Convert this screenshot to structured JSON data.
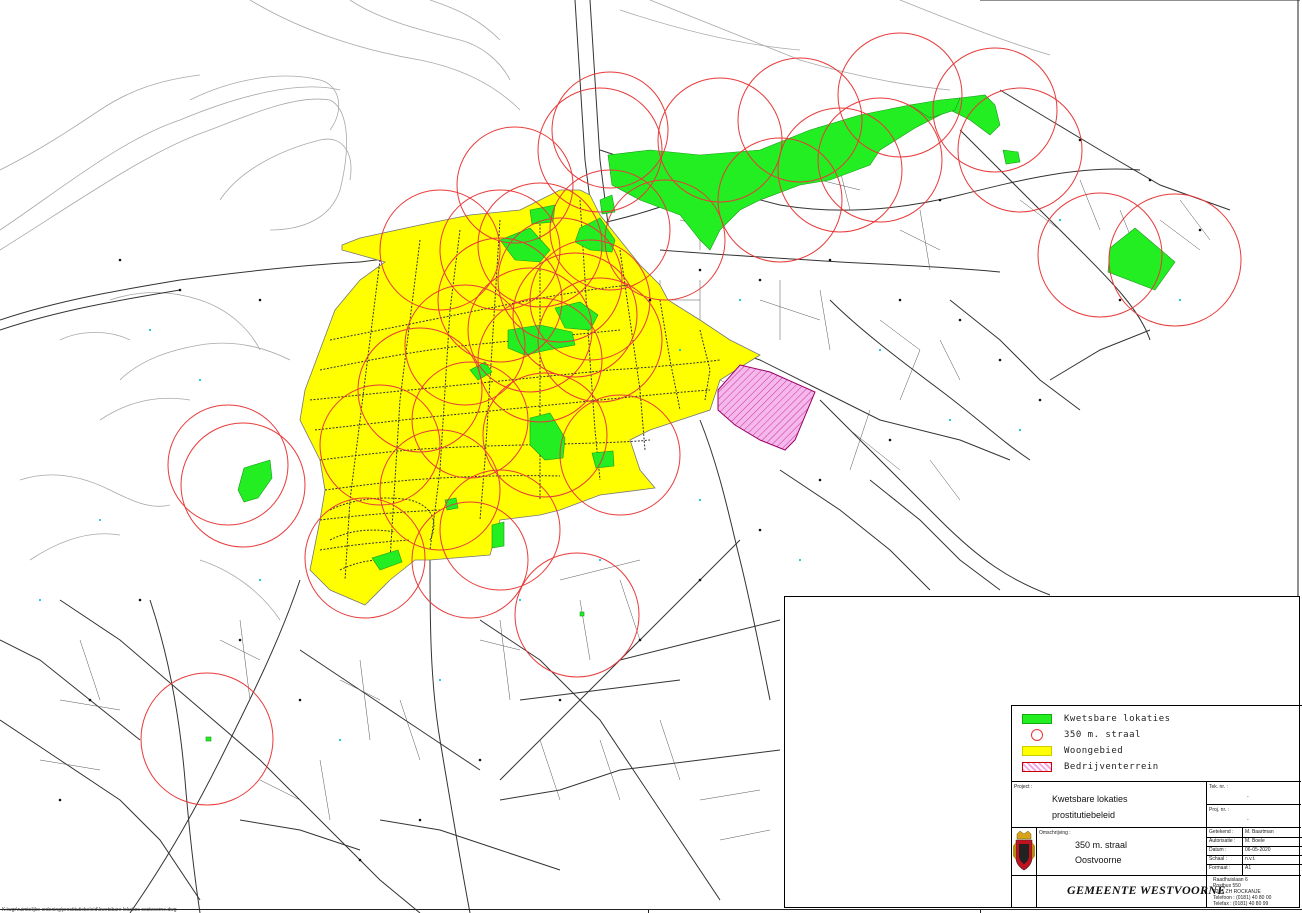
{
  "map": {
    "colors": {
      "kwetsbare": "#22ee22",
      "straal": "#e83a3a",
      "woongebied": "#ffff00",
      "bedrijventerrein": "#f3a7e6",
      "roads": "#333333",
      "contours": "#999999"
    }
  },
  "legend": {
    "items": [
      {
        "label": "Kwetsbare lokaties",
        "swatch": "green-fill"
      },
      {
        "label": "350 m. straal",
        "swatch": "red-circle"
      },
      {
        "label": "Woongebied",
        "swatch": "yellow-fill"
      },
      {
        "label": "Bedrijventerrein",
        "swatch": "pink-hatch"
      }
    ]
  },
  "titleblock": {
    "project_label": "Project :",
    "project_line1": "Kwetsbare lokaties",
    "project_line2": "prostitutiebeleid",
    "tek_nr_label": "Tek. nr. :",
    "tek_nr_value": "-",
    "proj_nr_label": "Proj. nr. :",
    "proj_nr_value": "-",
    "omschrijving_label": "Omschrijving :",
    "omschrijving_line1": "350 m. straal",
    "omschrijving_line2": "Oostvoorne",
    "getekend_label": "Getekend :",
    "getekend_value": "M. Baartman",
    "autorisatie_label": "Autorisatie :",
    "autorisatie_value": "M. Boele",
    "datum_label": "Datum :",
    "datum_value": "06-05-2020",
    "schaal_label": "Schaal :",
    "schaal_value": "n.v.t.",
    "formaat_label": "Formaat :",
    "formaat_value": "A1",
    "org_name": "GEMEENTE WESTVOORNE",
    "address": [
      "Raadhuislaan 6",
      "Postbus 550",
      "3235 ZH ROCKANJE",
      "Telefoon : (0181) 40 80 00",
      "Telefax : (0181) 40 80 99"
    ]
  },
  "footer": {
    "path_text": "K:\\wgr\\ruimtelijke ordening\\prostitutiebeleid\\kwetsbare lokaties oostvoorne.dwg"
  }
}
